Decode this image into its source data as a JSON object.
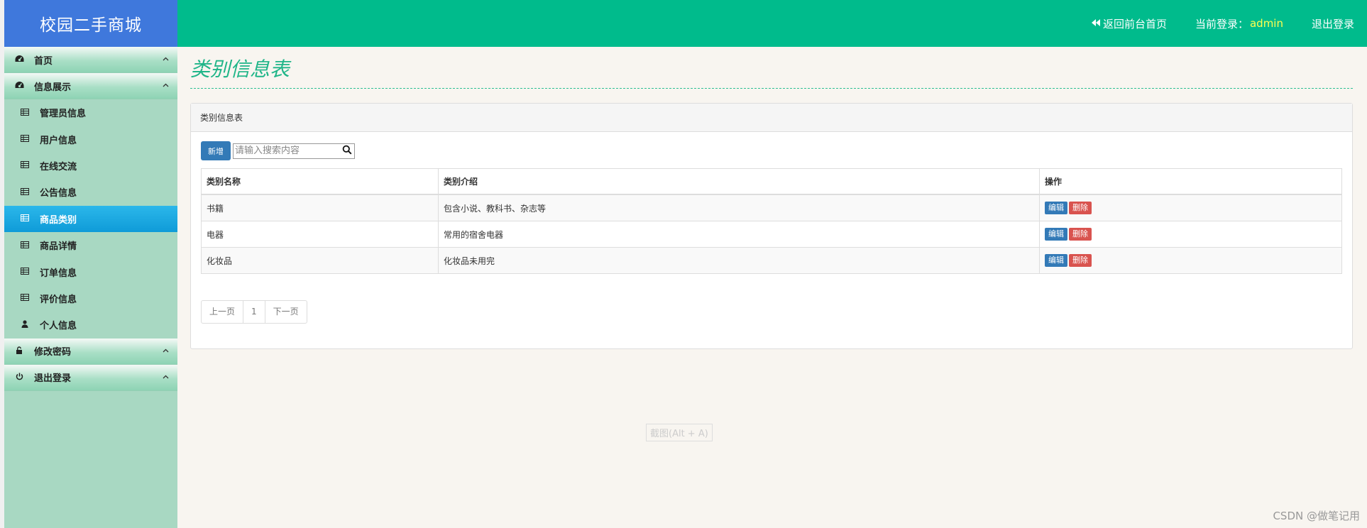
{
  "app": {
    "title": "校园二手商城"
  },
  "topbar": {
    "home_link": "返回前台首页",
    "login_label": "当前登录：",
    "username": "admin",
    "logout": "退出登录"
  },
  "sidebar": {
    "groups": [
      {
        "label": "首页",
        "icon": "dashboard-icon"
      },
      {
        "label": "信息展示",
        "icon": "dashboard-icon"
      }
    ],
    "items": [
      {
        "label": "管理员信息",
        "icon": "table-icon"
      },
      {
        "label": "用户信息",
        "icon": "table-icon"
      },
      {
        "label": "在线交流",
        "icon": "table-icon"
      },
      {
        "label": "公告信息",
        "icon": "table-icon"
      },
      {
        "label": "商品类别",
        "icon": "table-icon",
        "active": true
      },
      {
        "label": "商品详情",
        "icon": "table-icon"
      },
      {
        "label": "订单信息",
        "icon": "table-icon"
      },
      {
        "label": "评价信息",
        "icon": "table-icon"
      },
      {
        "label": "个人信息",
        "icon": "user-icon"
      }
    ],
    "bottom_groups": [
      {
        "label": "修改密码",
        "icon": "lock-icon"
      },
      {
        "label": "退出登录",
        "icon": "power-icon"
      }
    ]
  },
  "page": {
    "title": "类别信息表",
    "panel_title": "类别信息表"
  },
  "toolbar": {
    "add_label": "新增",
    "search_placeholder": "请输入搜索内容"
  },
  "table": {
    "columns": [
      "类别名称",
      "类别介绍",
      "操作"
    ],
    "rows": [
      {
        "name": "书籍",
        "desc": "包含小说、教科书、杂志等"
      },
      {
        "name": "电器",
        "desc": "常用的宿舍电器"
      },
      {
        "name": "化妆品",
        "desc": "化妆品未用完"
      }
    ],
    "edit_label": "编辑",
    "delete_label": "删除"
  },
  "pager": {
    "prev": "上一页",
    "page": "1",
    "next": "下一页"
  },
  "overlay": {
    "screenshot_hint": "截图(Alt + A)",
    "watermark": "CSDN @做笔记用"
  },
  "colors": {
    "brand": "#3f78dc",
    "topbar": "#00bb8c",
    "sidebar": "#a8d8c2",
    "active_item": "#1aa8e2",
    "title": "#1fb588",
    "username": "#ffff4f"
  }
}
